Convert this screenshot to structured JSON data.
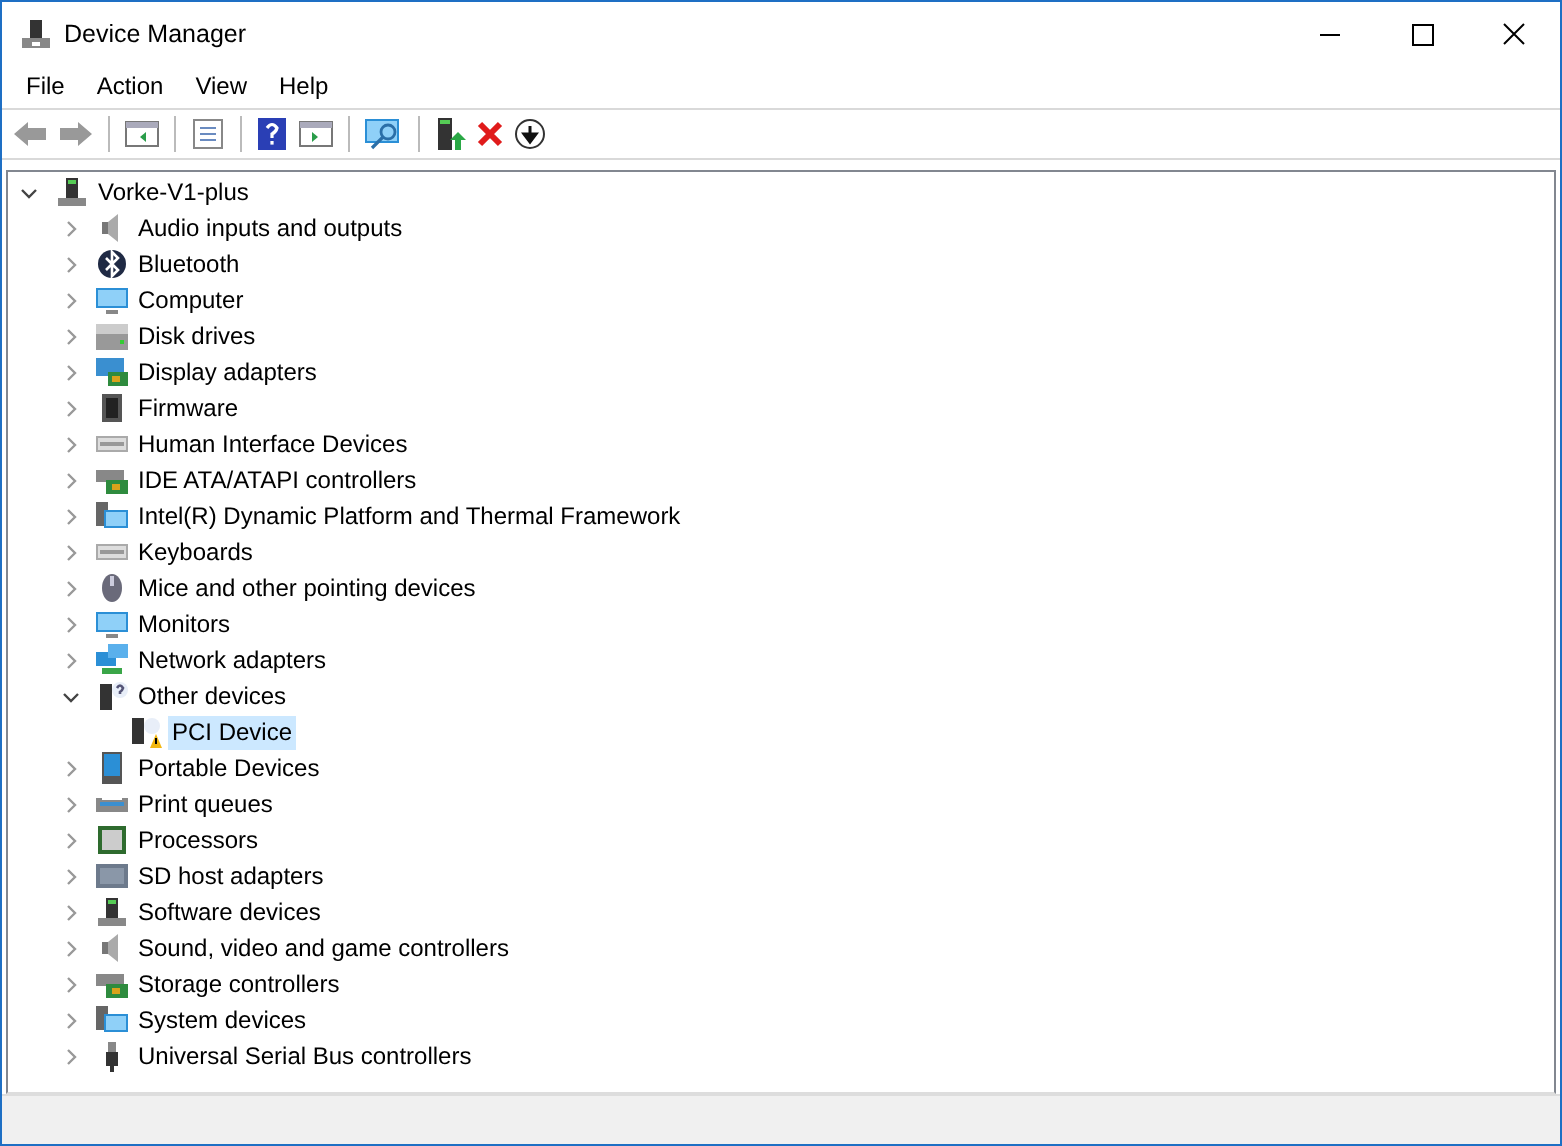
{
  "window": {
    "title": "Device Manager"
  },
  "menu": [
    "File",
    "Action",
    "View",
    "Help"
  ],
  "tree": {
    "label": "Vorke-V1-plus",
    "kind": "computer-tower",
    "expanded": true,
    "selected": false,
    "children": [
      {
        "label": "Audio inputs and outputs",
        "kind": "speaker",
        "expanded": false,
        "selected": false
      },
      {
        "label": "Bluetooth",
        "kind": "bluetooth",
        "expanded": false,
        "selected": false
      },
      {
        "label": "Computer",
        "kind": "monitor",
        "expanded": false,
        "selected": false
      },
      {
        "label": "Disk drives",
        "kind": "drive",
        "expanded": false,
        "selected": false
      },
      {
        "label": "Display adapters",
        "kind": "display-card",
        "expanded": false,
        "selected": false
      },
      {
        "label": "Firmware",
        "kind": "chip",
        "expanded": false,
        "selected": false
      },
      {
        "label": "Human Interface Devices",
        "kind": "keyboard",
        "expanded": false,
        "selected": false
      },
      {
        "label": "IDE ATA/ATAPI controllers",
        "kind": "controller",
        "expanded": false,
        "selected": false
      },
      {
        "label": "Intel(R) Dynamic Platform and Thermal Framework",
        "kind": "system",
        "expanded": false,
        "selected": false
      },
      {
        "label": "Keyboards",
        "kind": "keyboard",
        "expanded": false,
        "selected": false
      },
      {
        "label": "Mice and other pointing devices",
        "kind": "mouse",
        "expanded": false,
        "selected": false
      },
      {
        "label": "Monitors",
        "kind": "monitor",
        "expanded": false,
        "selected": false
      },
      {
        "label": "Network adapters",
        "kind": "network",
        "expanded": false,
        "selected": false
      },
      {
        "label": "Other devices",
        "kind": "unknown",
        "expanded": true,
        "selected": false,
        "children": [
          {
            "label": "PCI Device",
            "kind": "warning",
            "selected": true
          }
        ]
      },
      {
        "label": "Portable Devices",
        "kind": "portable",
        "expanded": false,
        "selected": false
      },
      {
        "label": "Print queues",
        "kind": "printer",
        "expanded": false,
        "selected": false
      },
      {
        "label": "Processors",
        "kind": "chip-square",
        "expanded": false,
        "selected": false
      },
      {
        "label": "SD host adapters",
        "kind": "card",
        "expanded": false,
        "selected": false
      },
      {
        "label": "Software devices",
        "kind": "computer-tower",
        "expanded": false,
        "selected": false
      },
      {
        "label": "Sound, video and game controllers",
        "kind": "speaker",
        "expanded": false,
        "selected": false
      },
      {
        "label": "Storage controllers",
        "kind": "controller",
        "expanded": false,
        "selected": false
      },
      {
        "label": "System devices",
        "kind": "system",
        "expanded": false,
        "selected": false
      },
      {
        "label": "Universal Serial Bus controllers",
        "kind": "usb",
        "expanded": false,
        "selected": false
      }
    ]
  }
}
